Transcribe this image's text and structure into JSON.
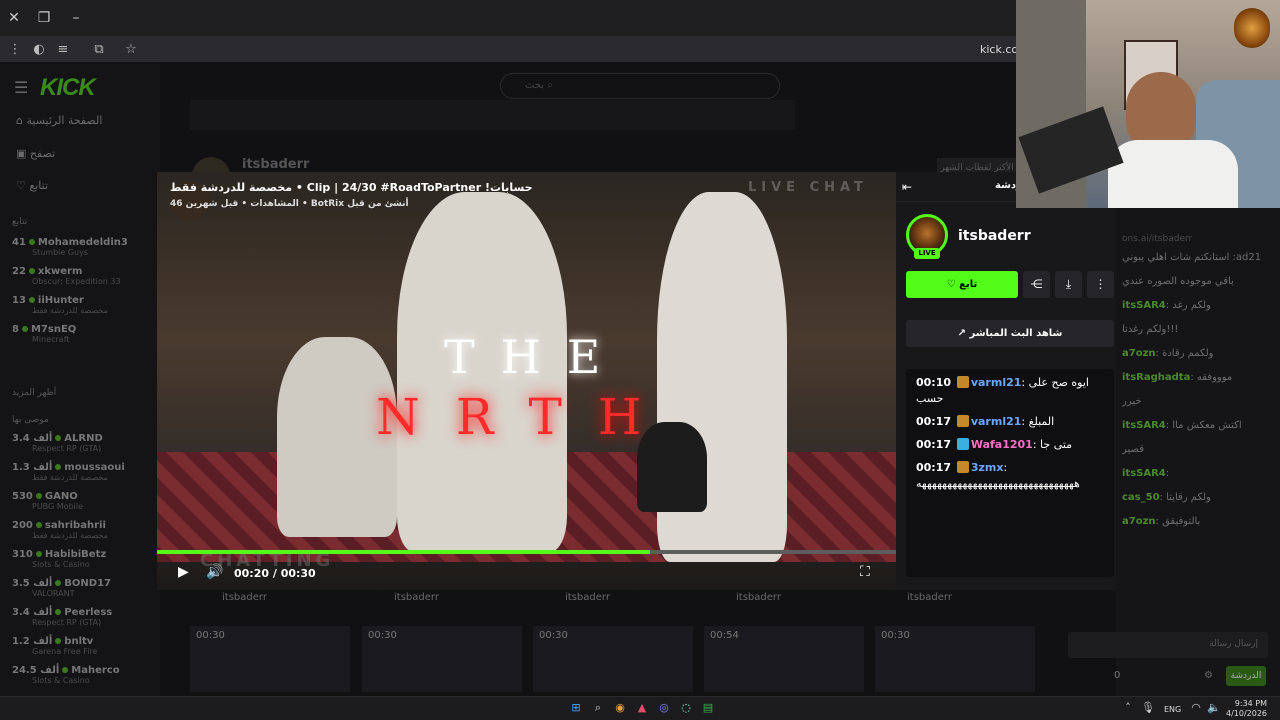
{
  "browser": {
    "url": "kick.com",
    "window_controls": [
      "close-icon",
      "restore-icon",
      "minimize-icon"
    ]
  },
  "site": {
    "logo": "KICK",
    "search_placeholder": "بحث",
    "nav": [
      {
        "icon": "home-icon",
        "label": "الصفحة الرئيسية"
      },
      {
        "icon": "browse-icon",
        "label": "تصفح"
      },
      {
        "icon": "heart-icon",
        "label": "تتابع"
      }
    ],
    "following_heading": "تتابع",
    "show_more": "أظهر المزيد",
    "recommended_heading": "موصى بها",
    "followed_channels": [
      {
        "name": "Mohamedeldin3",
        "viewers": "41",
        "game": "Stumble Guys"
      },
      {
        "name": "xkwerm",
        "viewers": "22",
        "game": "Obscur: Expedition 33"
      },
      {
        "name": "iiHunter",
        "viewers": "13",
        "game": "مخصصة للدردشة فقط"
      },
      {
        "name": "M7snEQ",
        "viewers": "8",
        "game": "Minecraft"
      }
    ],
    "recommended_channels": [
      {
        "name": "ALRND",
        "viewers": "3.4 ألف",
        "game": "Respect RP (GTA)"
      },
      {
        "name": "moussaoui",
        "viewers": "1.3 ألف",
        "game": "مخصصة للدردشة فقط"
      },
      {
        "name": "GANO",
        "viewers": "530",
        "game": "PUBG Mobile"
      },
      {
        "name": "sahribahrii",
        "viewers": "200",
        "game": "مخصصة للدردشة فقط"
      },
      {
        "name": "HabibiBetz",
        "viewers": "310",
        "game": "Slots & Casino"
      },
      {
        "name": "BOND17",
        "viewers": "3.5 ألف",
        "game": "VALORANT"
      },
      {
        "name": "Peerless",
        "viewers": "3.4 ألف",
        "game": "Respect RP (GTA)"
      },
      {
        "name": "bnltv",
        "viewers": "1.2 ألف",
        "game": "Garena Free Fire"
      },
      {
        "name": "Maherco",
        "viewers": "24.5 ألف",
        "game": "Slots & Casino"
      }
    ],
    "bg_channel_name": "itsbaderr",
    "bg_top_clips": "الأكثر لقطات الشهر"
  },
  "clip": {
    "title": "مخصصة للدردشة فقط • Clip | 24/30 #RoadToPartner !حسابات",
    "meta": "المشاهدات • قبل شهرين 46 • BotRix أنشئ من قبل",
    "overlay_the": "THE",
    "overlay_north": "NRTH",
    "overlay_livechat": "LIVE CHAT",
    "overlay_chatting": "CHATTING",
    "time_display": "00:20 / 00:30",
    "progress": 0.667,
    "panel_heading": "دردشة",
    "channel": "itsbaderr",
    "live_badge": "LIVE",
    "follow_label": "تابع",
    "watch_live_label": "شاهد البث المباشر",
    "chat": [
      {
        "time": "00:10",
        "user": "varml21",
        "color": "#6aa8ff",
        "text": "ايوه صح على حسب"
      },
      {
        "time": "00:17",
        "user": "varml21",
        "color": "#6aa8ff",
        "text": "المبلغ"
      },
      {
        "time": "00:17",
        "user": "Wafa1201",
        "color": "#ff6ec7",
        "text": "متى جا"
      },
      {
        "time": "00:17",
        "user": "3zmx",
        "color": "#6aa8ff",
        "text": "هههههههههههههههههههههههههههههههه"
      }
    ]
  },
  "below_clips": {
    "names": [
      "itsbaderr",
      "itsbaderr",
      "itsbaderr",
      "itsbaderr",
      "itsbaderr"
    ],
    "durations": [
      "00:30",
      "00:30",
      "00:30",
      "00:54",
      "00:30"
    ]
  },
  "right_chat": {
    "lines": [
      {
        "user": "",
        "text": "استانكتم شات اهلي يبوني :ad21"
      },
      {
        "user": "",
        "text": "باقي موجوده الصوره عندي"
      },
      {
        "user": "itsSAR4",
        "text": "ولكم رغد"
      },
      {
        "user": "",
        "text": "ولكم رغدتا!!!"
      },
      {
        "user": "a7ozn",
        "text": "ولكمم رقادة"
      },
      {
        "user": "itsRaghadta",
        "text": "موووفقه"
      },
      {
        "user": "",
        "text": "خيرر"
      },
      {
        "user": "itsSAR4",
        "text": "اكتش معكش ماا"
      },
      {
        "user": "",
        "text": "قصير"
      },
      {
        "user": "itsSAR4",
        "text": ""
      },
      {
        "user": "cas_50",
        "text": "ولكم رقايتا"
      },
      {
        "user": "a7ozn",
        "text": "بالتوفيقق"
      }
    ],
    "input_placeholder": "إرسال رسالة",
    "chat_button": "الدردشة",
    "points": "0",
    "banner": "ons.ai/itsbaderr"
  },
  "taskbar": {
    "lang": "ENG",
    "time": "9:34 PM",
    "date": "4/10/2026"
  }
}
